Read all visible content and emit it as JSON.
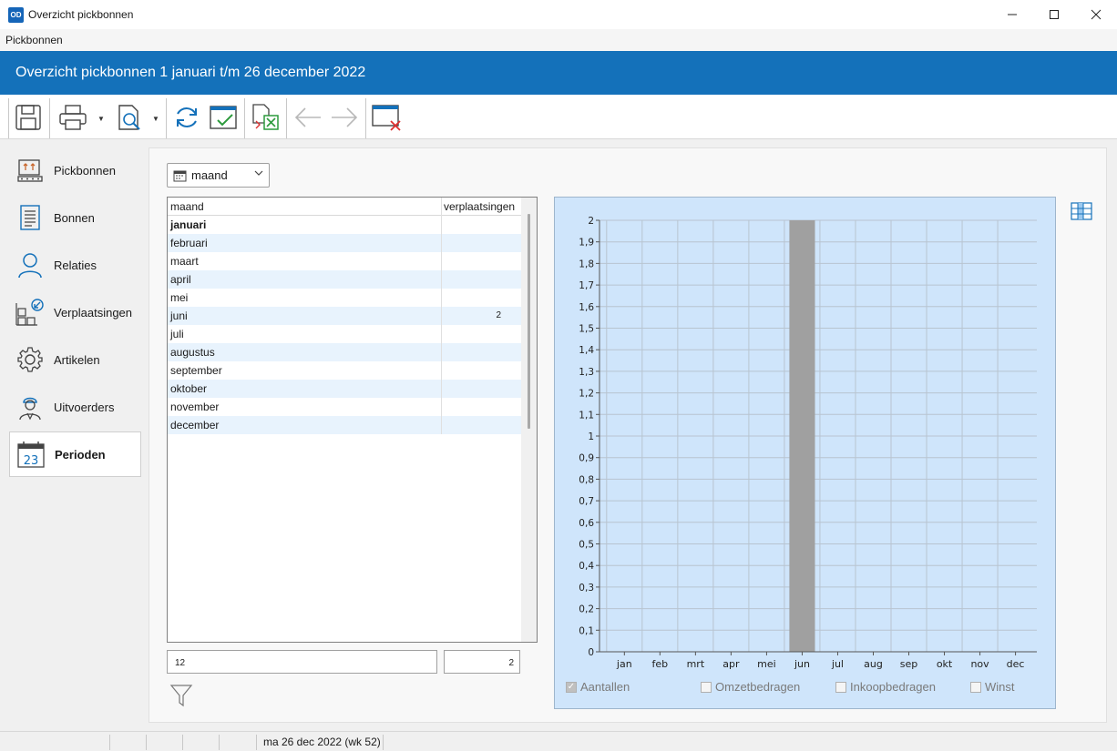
{
  "window": {
    "title": "Overzicht pickbonnen",
    "logo": "OD",
    "controls": [
      "minimize-icon",
      "maximize-icon",
      "close-icon"
    ]
  },
  "menu": {
    "items": [
      "Pickbonnen"
    ]
  },
  "header": {
    "title": "Overzicht pickbonnen 1 januari t/m 26 december 2022"
  },
  "toolbar": {
    "icons": [
      "save-icon",
      "print-icon",
      "preview-icon",
      "refresh-icon",
      "apply-icon",
      "export-excel-icon",
      "back-arrow-icon",
      "forward-arrow-icon",
      "close-window-icon"
    ]
  },
  "sidebar": {
    "items": [
      {
        "label": "Pickbonnen",
        "icon": "pickbonnen-icon",
        "active": false
      },
      {
        "label": "Bonnen",
        "icon": "document-icon",
        "active": false
      },
      {
        "label": "Relaties",
        "icon": "person-icon",
        "active": false
      },
      {
        "label": "Verplaatsingen",
        "icon": "transfer-icon",
        "active": false
      },
      {
        "label": "Artikelen",
        "icon": "gear-icon",
        "active": false
      },
      {
        "label": "Uitvoerders",
        "icon": "worker-icon",
        "active": false
      },
      {
        "label": "Perioden",
        "icon": "calendar-icon",
        "active": true
      }
    ]
  },
  "period_select": {
    "value": "maand",
    "icon": "calendar-small-icon"
  },
  "grid": {
    "headers": [
      "maand",
      "verplaatsingen"
    ],
    "rows": [
      {
        "maand": "januari",
        "verplaatsingen": ""
      },
      {
        "maand": "februari",
        "verplaatsingen": ""
      },
      {
        "maand": "maart",
        "verplaatsingen": ""
      },
      {
        "maand": "april",
        "verplaatsingen": ""
      },
      {
        "maand": "mei",
        "verplaatsingen": ""
      },
      {
        "maand": "juni",
        "verplaatsingen": "2"
      },
      {
        "maand": "juli",
        "verplaatsingen": ""
      },
      {
        "maand": "augustus",
        "verplaatsingen": ""
      },
      {
        "maand": "september",
        "verplaatsingen": ""
      },
      {
        "maand": "oktober",
        "verplaatsingen": ""
      },
      {
        "maand": "november",
        "verplaatsingen": ""
      },
      {
        "maand": "december",
        "verplaatsingen": ""
      }
    ],
    "count": "12",
    "total": "2"
  },
  "checkboxes": [
    {
      "label": "Aantallen",
      "checked": true
    },
    {
      "label": "Omzetbedragen",
      "checked": false
    },
    {
      "label": "Inkoopbedragen",
      "checked": false
    },
    {
      "label": "Winst",
      "checked": false
    }
  ],
  "chart_data": {
    "type": "bar",
    "categories": [
      "jan",
      "feb",
      "mrt",
      "apr",
      "mei",
      "jun",
      "jul",
      "aug",
      "sep",
      "okt",
      "nov",
      "dec"
    ],
    "values": [
      0,
      0,
      0,
      0,
      0,
      2,
      0,
      0,
      0,
      0,
      0,
      0
    ],
    "yticks": [
      "0",
      "0,1",
      "0,2",
      "0,3",
      "0,4",
      "0,5",
      "0,6",
      "0,7",
      "0,8",
      "0,9",
      "1",
      "1,1",
      "1,2",
      "1,3",
      "1,4",
      "1,5",
      "1,6",
      "1,7",
      "1,8",
      "1,9",
      "2"
    ],
    "ylim": [
      0,
      2
    ],
    "grid": true,
    "bar_color": "#a0a0a0",
    "background": "#cfe5fb"
  },
  "status": {
    "date": "ma 26 dec 2022 (wk 52)"
  },
  "colors": {
    "header": "#1471ba",
    "row_alt": "#e8f3fd",
    "chart_bg": "#cfe5fb"
  }
}
